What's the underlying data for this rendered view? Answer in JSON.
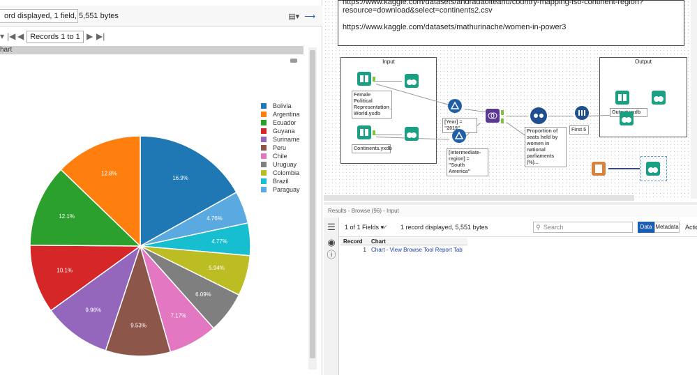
{
  "left": {
    "summary": "ord displayed, 1 field, 5,551 bytes",
    "records_label": "Records 1 to 1",
    "chart_header": "hart"
  },
  "colors": {
    "Bolivia": "#1f77b4",
    "Argentina": "#ff7f0e",
    "Ecuador": "#2ca02c",
    "Guyana": "#d62728",
    "Suriname": "#9467bd",
    "Peru": "#8c564b",
    "Chile": "#e377c2",
    "Uruguay": "#7f7f7f",
    "Colombia": "#bcbd22",
    "Brazil": "#17becf",
    "Paraguay": "#5aa9e0"
  },
  "chart_data": {
    "type": "pie",
    "legend_position": "top-right",
    "slices": [
      {
        "label": "Bolivia",
        "value": 16.9,
        "text": "16.9%"
      },
      {
        "label": "Paraguay",
        "value": 4.76,
        "text": "4.76%"
      },
      {
        "label": "Brazil",
        "value": 4.77,
        "text": "4.77%"
      },
      {
        "label": "Colombia",
        "value": 5.94,
        "text": "5.94%"
      },
      {
        "label": "Uruguay",
        "value": 6.09,
        "text": "6.09%"
      },
      {
        "label": "Chile",
        "value": 7.17,
        "text": "7.17%"
      },
      {
        "label": "Peru",
        "value": 9.53,
        "text": "9.53%"
      },
      {
        "label": "Suriname",
        "value": 9.96,
        "text": "9.96%"
      },
      {
        "label": "Guyana",
        "value": 10.1,
        "text": "10.1%"
      },
      {
        "label": "Ecuador",
        "value": 12.1,
        "text": "12.1%"
      },
      {
        "label": "Argentina",
        "value": 12.8,
        "text": "12.8%"
      }
    ],
    "legend": [
      "Bolivia",
      "Argentina",
      "Ecuador",
      "Guyana",
      "Suriname",
      "Peru",
      "Chile",
      "Uruguay",
      "Colombia",
      "Brazil",
      "Paraguay"
    ]
  },
  "canvas": {
    "comment_line1": "https://www.kaggle.com/datasets/andradaolteanu/country-mapping-iso-continent-region?",
    "comment_line2": "resource=download&select=continents2.csv",
    "comment_line3": "https://www.kaggle.com/datasets/mathurinache/women-in-power3",
    "input_box_title": "Input",
    "output_box_title": "Output",
    "annot_female": "Female Political Representation_ World.yxdb",
    "annot_continents": "Continents.yxdb",
    "annot_filter1": "[Year] = \"2019\"",
    "annot_filter2": "[intermediate-region] = \"South America\"",
    "annot_formula": "Proportion of seats held by women in national parliaments (%)...",
    "annot_sample": "First 5",
    "annot_output": "Output.yxdb",
    "port_labels": [
      "T",
      "F",
      "L",
      "J",
      "R"
    ]
  },
  "results": {
    "title": "Results - Browse (96) - Input",
    "fields_dropdown": "1 of 1 Fields",
    "summary": "1 record displayed, 5,551 bytes",
    "search_placeholder": "Search",
    "tab_data": "Data",
    "tab_metadata": "Metadata",
    "actions": "Actions",
    "columns": [
      "Record",
      "Chart"
    ],
    "rows": [
      {
        "record": "1",
        "chart": "Chart - View Browse Tool Report Tab"
      }
    ]
  }
}
